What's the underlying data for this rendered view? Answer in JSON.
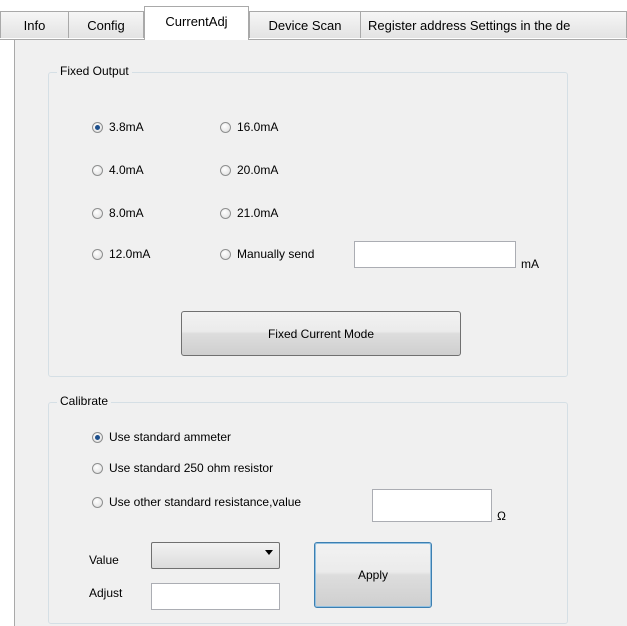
{
  "tabs": [
    {
      "label": "Info",
      "active": false
    },
    {
      "label": "Config",
      "active": false
    },
    {
      "label": "CurrentAdj",
      "active": true
    },
    {
      "label": "Device Scan",
      "active": false
    },
    {
      "label": "Register address Settings in the de",
      "active": false
    }
  ],
  "fixed_output": {
    "title": "Fixed Output",
    "options": [
      {
        "label": "3.8mA",
        "selected": true
      },
      {
        "label": "16.0mA",
        "selected": false
      },
      {
        "label": "4.0mA",
        "selected": false
      },
      {
        "label": "20.0mA",
        "selected": false
      },
      {
        "label": "8.0mA",
        "selected": false
      },
      {
        "label": "21.0mA",
        "selected": false
      },
      {
        "label": "12.0mA",
        "selected": false
      },
      {
        "label": "Manually send",
        "selected": false
      }
    ],
    "manual_value": "",
    "manual_unit": "mA",
    "button_label": "Fixed Current Mode"
  },
  "calibrate": {
    "title": "Calibrate",
    "options": [
      {
        "label": "Use standard ammeter",
        "selected": true
      },
      {
        "label": "Use standard 250 ohm resistor",
        "selected": false
      },
      {
        "label": "Use other standard resistance,value",
        "selected": false
      }
    ],
    "resistance_value": "",
    "resistance_unit": "Ω",
    "value_label": "Value",
    "value_selected": "",
    "adjust_label": "Adjust",
    "adjust_value": "",
    "apply_label": "Apply"
  }
}
